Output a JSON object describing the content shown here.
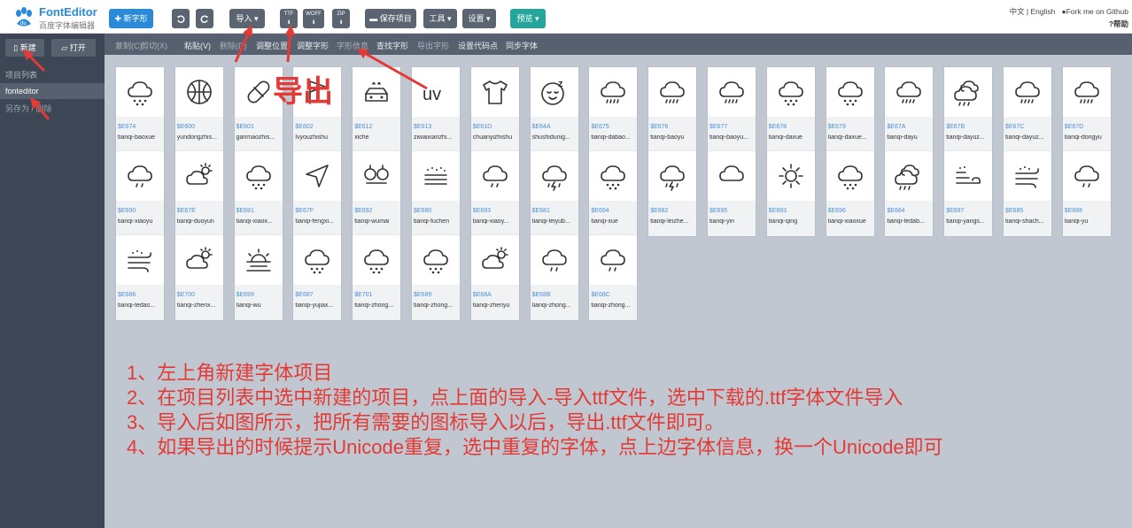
{
  "app": {
    "title": "FontEditor",
    "subtitle": "百度字体编辑器"
  },
  "toolbar": {
    "new_glyph": "新字形",
    "import": "导入",
    "ttf": "TTF",
    "woff": "WOFF",
    "zip": "ZIP",
    "save_project": "保存项目",
    "tools": "工具",
    "settings": "设置",
    "preview": "预览"
  },
  "toplinks": {
    "lang": "中文 | English",
    "github": "Fork me on Github",
    "help": "帮助"
  },
  "sidebar": {
    "new": "新建",
    "open": "打开",
    "project_list": "项目列表",
    "project": "fonteditor",
    "save_as": "另存为 / 删除"
  },
  "menu": [
    {
      "label": "复制(C)",
      "dim": true
    },
    {
      "label": "剪切(X)",
      "dim": true
    },
    {
      "label": "粘贴(V)",
      "dim": false
    },
    {
      "label": "删除(D)",
      "dim": true
    },
    {
      "label": "调整位置",
      "dim": false
    },
    {
      "label": "调整字形",
      "dim": false
    },
    {
      "label": "字形信息",
      "dim": true
    },
    {
      "label": "查找字形",
      "dim": false
    },
    {
      "label": "导出字形",
      "dim": true
    },
    {
      "label": "设置代码点",
      "dim": false
    },
    {
      "label": "同步字体",
      "dim": false
    }
  ],
  "glyphs": [
    {
      "code": "$E674",
      "name": "tianqi-baoxue",
      "icon": "cloud-snow-icon"
    },
    {
      "code": "$E600",
      "name": "yundongzhis...",
      "icon": "basketball-icon"
    },
    {
      "code": "$E601",
      "name": "ganmaozhis...",
      "icon": "pill-icon"
    },
    {
      "code": "$E602",
      "name": "lvyouzhishu",
      "icon": "flag-icon"
    },
    {
      "code": "$E612",
      "name": "xiche",
      "icon": "car-wash-icon"
    },
    {
      "code": "$E613",
      "name": "ziwaixianzhi...",
      "icon": "uv-icon"
    },
    {
      "code": "$E61D",
      "name": "chuanyizhishu",
      "icon": "tshirt-icon"
    },
    {
      "code": "$E64A",
      "name": "shushidunig...",
      "icon": "sleep-face-icon"
    },
    {
      "code": "$E675",
      "name": "tianqi-dabao...",
      "icon": "cloud-rain-icon"
    },
    {
      "code": "$E676",
      "name": "tianqi-baoyu",
      "icon": "cloud-rain-icon"
    },
    {
      "code": "$E677",
      "name": "tianqi-baoyu...",
      "icon": "cloud-rain-icon"
    },
    {
      "code": "$E678",
      "name": "tianqi-daxue",
      "icon": "cloud-snow-icon"
    },
    {
      "code": "$E679",
      "name": "tianqi-daxue...",
      "icon": "cloud-snow-icon"
    },
    {
      "code": "$E67A",
      "name": "tianqi-dayu",
      "icon": "cloud-rain-icon"
    },
    {
      "code": "$E67B",
      "name": "tianqi-dayuz...",
      "icon": "double-cloud-icon"
    },
    {
      "code": "$E67C",
      "name": "tianqi-dayuz...",
      "icon": "cloud-rain-icon"
    },
    {
      "code": "$E67D",
      "name": "tianqi-dongyu",
      "icon": "cloud-rain-icon"
    },
    {
      "code": "$E690",
      "name": "tianqi-xiaoyu",
      "icon": "cloud-drizzle-icon"
    },
    {
      "code": "$E67E",
      "name": "tianqi-duoyun",
      "icon": "cloud-sun-icon"
    },
    {
      "code": "$E691",
      "name": "tianqi-xiaox...",
      "icon": "cloud-snow-icon"
    },
    {
      "code": "$E67F",
      "name": "tianqi-fengxi...",
      "icon": "navigation-icon"
    },
    {
      "code": "$E692",
      "name": "tianqi-wumai",
      "icon": "haze-icon"
    },
    {
      "code": "$E680",
      "name": "tianqi-fuchen",
      "icon": "dust-icon"
    },
    {
      "code": "$E693",
      "name": "tianqi-xiaoy...",
      "icon": "cloud-drizzle-icon"
    },
    {
      "code": "$E681",
      "name": "tianqi-leiyub...",
      "icon": "cloud-lightning-icon"
    },
    {
      "code": "$E694",
      "name": "tianqi-xue",
      "icon": "cloud-snow-icon"
    },
    {
      "code": "$E682",
      "name": "tianqi-leizhe...",
      "icon": "cloud-lightning-icon"
    },
    {
      "code": "$E695",
      "name": "tianqi-yin",
      "icon": "cloud-icon"
    },
    {
      "code": "$E683",
      "name": "tianqi-qing",
      "icon": "sun-icon"
    },
    {
      "code": "$E696",
      "name": "tianqi-xiaoxue",
      "icon": "cloud-snow-icon"
    },
    {
      "code": "$E684",
      "name": "tianqi-tedab...",
      "icon": "double-cloud-icon"
    },
    {
      "code": "$E697",
      "name": "tianqi-yangs...",
      "icon": "wind-icon"
    },
    {
      "code": "$E685",
      "name": "tianqi-shach...",
      "icon": "sandstorm-icon"
    },
    {
      "code": "$E688",
      "name": "tianqi-yu",
      "icon": "cloud-drizzle-icon"
    },
    {
      "code": "$E686",
      "name": "tianqi-tedas...",
      "icon": "sandstorm-icon"
    },
    {
      "code": "$E700",
      "name": "tianqi-zhenx...",
      "icon": "cloud-sun-icon"
    },
    {
      "code": "$E699",
      "name": "tianqi-wu",
      "icon": "fog-icon"
    },
    {
      "code": "$E687",
      "name": "tianqi-yujiax...",
      "icon": "cloud-snow-icon"
    },
    {
      "code": "$E701",
      "name": "tianqi-zhong...",
      "icon": "cloud-snow-icon"
    },
    {
      "code": "$E689",
      "name": "tianqi-zhong...",
      "icon": "cloud-snow-icon"
    },
    {
      "code": "$E68A",
      "name": "tianqi-zhenyu",
      "icon": "cloud-sun-icon"
    },
    {
      "code": "$E68B",
      "name": "tianqi-zhong...",
      "icon": "cloud-drizzle-icon"
    },
    {
      "code": "$E68C",
      "name": "tianqi-zhong...",
      "icon": "cloud-drizzle-icon"
    }
  ],
  "annotation": {
    "export_label": "导出",
    "steps": [
      "1、左上角新建字体项目",
      "2、在项目列表中选中新建的项目，点上面的导入-导入ttf文件，选中下载的.ttf字体文件导入",
      "3、导入后如图所示，把所有需要的图标导入以后，导出.ttf文件即可。",
      "4、如果导出的时候提示Unicode重复，选中重复的字体，点上边字体信息，换一个Unicode即可"
    ],
    "color": "#e53935"
  }
}
